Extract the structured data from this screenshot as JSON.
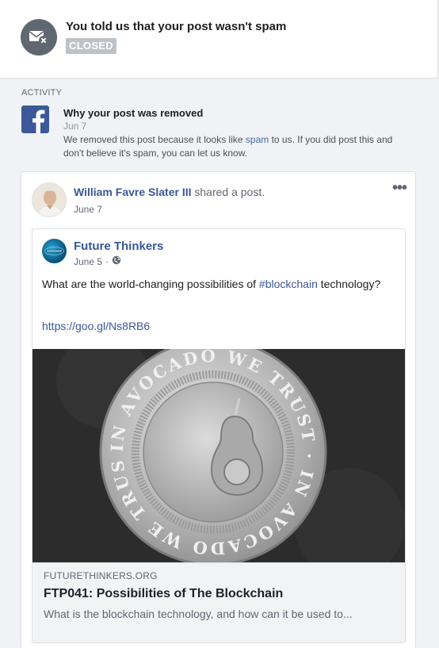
{
  "header": {
    "title": "You told us that your post wasn't spam",
    "status": "CLOSED",
    "icon": "envelope-x-icon"
  },
  "activity": {
    "label": "ACTIVITY",
    "title": "Why your post was removed",
    "date": "Jun 7",
    "desc_part1": "We removed this post because it looks like ",
    "desc_link": "spam",
    "desc_part2": " to us. If you did post this and don't believe it's spam, you can let us know.",
    "icon": "facebook-logo-icon"
  },
  "shared_post": {
    "author": "William Favre Slater III",
    "action": " shared a post.",
    "date": "June 7",
    "more_icon": "ellipsis-icon",
    "original": {
      "page_name": "Future Thinkers",
      "date": "June 5",
      "separator": "·",
      "privacy_icon": "globe-icon",
      "text_part1": "What are the world-changing possibilities of ",
      "hashtag": "#blockchain",
      "text_part2": " technology?",
      "link": "https://goo.gl/Ns8RB6"
    },
    "link_preview": {
      "domain": "FUTURETHINKERS.ORG",
      "title": "FTP041: Possibilities of The Blockchain",
      "description": "What is the blockchain technology, and how can it be used to...",
      "coin_text": "IN AVOCADO WE TRUST · IN AVOCADO WE TRUST"
    }
  },
  "colors": {
    "link": "#385898",
    "facebook_blue": "#3b5998",
    "badge_gray": "#bec3c9",
    "background": "#f0f2f5"
  }
}
